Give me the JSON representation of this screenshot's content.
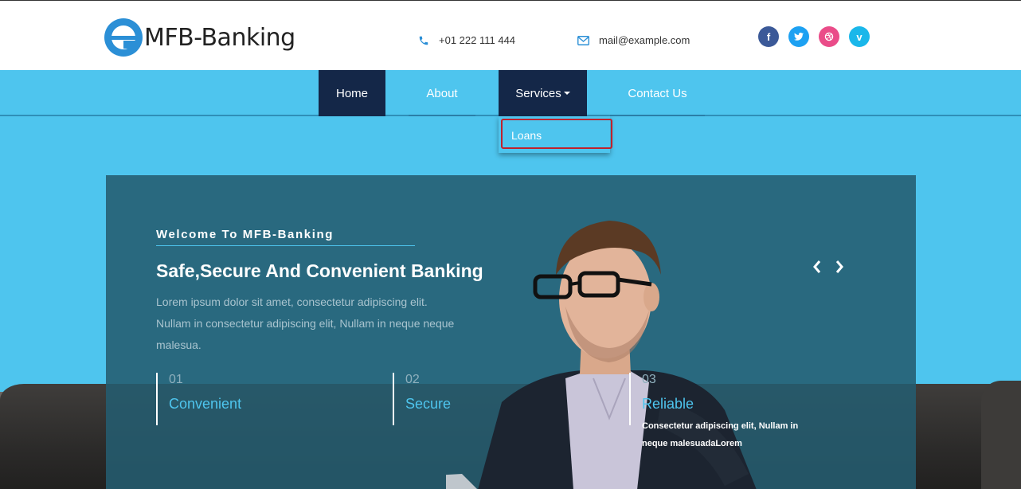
{
  "brand": {
    "name": "MFB-Banking",
    "logo_icon": "e-logo-icon",
    "color": "#2b8fd6"
  },
  "contact": {
    "phone": "+01 222 111 444",
    "email": "mail@example.com"
  },
  "social": [
    {
      "label": "f",
      "icon": "facebook-icon",
      "color": "#3b5998"
    },
    {
      "label": "t",
      "icon": "twitter-icon",
      "color": "#1da1f2"
    },
    {
      "label": "⊙",
      "icon": "dribbble-icon",
      "color": "#ea4c89"
    },
    {
      "label": "v",
      "icon": "vimeo-icon",
      "color": "#1ab7ea"
    }
  ],
  "nav": {
    "home": "Home",
    "about": "About",
    "services": "Services",
    "contact": "Contact Us"
  },
  "dropdown": {
    "loans": "Loans"
  },
  "hero": {
    "welcome": "Welcome To MFB-Banking",
    "title": "Safe,Secure And Convenient Banking",
    "body": "Lorem ipsum dolor sit amet, consectetur adipiscing elit. Nullam in consectetur adipiscing elit, Nullam in neque neque malesua."
  },
  "features": [
    {
      "num": "01",
      "title": "Convenient"
    },
    {
      "num": "02",
      "title": "Secure"
    },
    {
      "num": "03",
      "title": "Reliable",
      "desc": "Consectetur adipiscing elit, Nullam in neque malesuadaLorem"
    }
  ],
  "colors": {
    "accent": "#4ec5ee",
    "nav_dark": "#142748",
    "panel": "#245c70"
  }
}
